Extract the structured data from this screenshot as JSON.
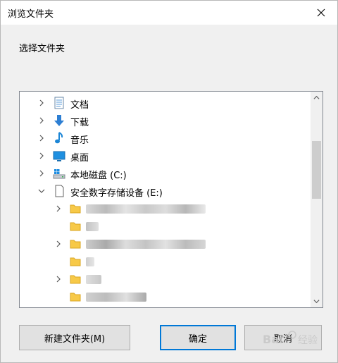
{
  "window": {
    "title": "浏览文件夹"
  },
  "prompt": "选择文件夹",
  "tree": {
    "items": [
      {
        "label": "文档",
        "icon": "documents-icon",
        "expanded": false
      },
      {
        "label": "下载",
        "icon": "download-icon",
        "expanded": false
      },
      {
        "label": "音乐",
        "icon": "music-icon",
        "expanded": false
      },
      {
        "label": "桌面",
        "icon": "desktop-icon",
        "expanded": false
      },
      {
        "label": "本地磁盘 (C:)",
        "icon": "drive-icon",
        "expanded": false
      },
      {
        "label": "安全数字存储设备 (E:)",
        "icon": "sd-card-icon",
        "expanded": true
      }
    ],
    "subfolders": [
      {
        "has_children": true
      },
      {
        "has_children": false
      },
      {
        "has_children": true
      },
      {
        "has_children": false
      },
      {
        "has_children": true
      },
      {
        "has_children": false
      }
    ]
  },
  "buttons": {
    "new_folder": "新建文件夹(M)",
    "ok": "确定",
    "cancel": "取消"
  },
  "watermark": "Bai 经验"
}
